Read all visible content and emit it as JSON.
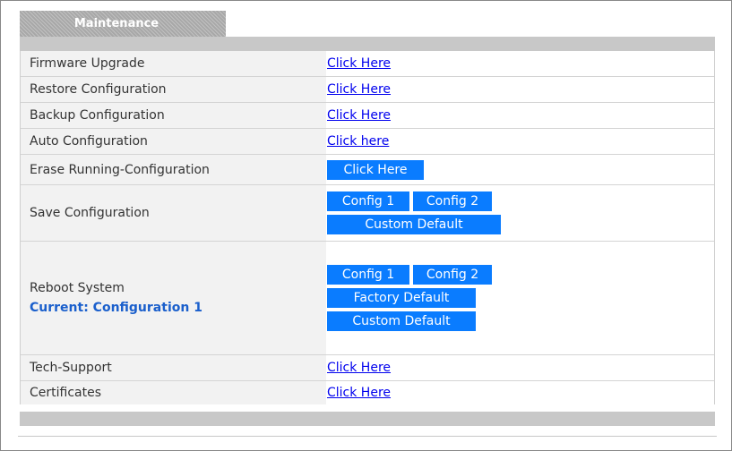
{
  "panel": {
    "title": "Maintenance"
  },
  "rows": {
    "firmware_upgrade": {
      "label": "Firmware Upgrade",
      "action": "Click Here"
    },
    "restore_configuration": {
      "label": "Restore Configuration",
      "action": "Click Here"
    },
    "backup_configuration": {
      "label": "Backup Configuration",
      "action": "Click Here"
    },
    "auto_configuration": {
      "label": "Auto Configuration",
      "action": "Click here"
    },
    "erase_running": {
      "label": "Erase Running-Configuration",
      "action": "Click Here"
    },
    "save_configuration": {
      "label": "Save Configuration",
      "config1": "Config 1",
      "config2": "Config 2",
      "custom_default": "Custom Default"
    },
    "reboot_system": {
      "label": "Reboot System",
      "current": "Current: Configuration 1",
      "config1": "Config 1",
      "config2": "Config 2",
      "factory_default": "Factory Default",
      "custom_default": "Custom Default"
    },
    "tech_support": {
      "label": "Tech-Support",
      "action": "Click Here"
    },
    "certificates": {
      "label": "Certificates",
      "action": "Click Here"
    }
  },
  "colors": {
    "button": "#0a7cff",
    "link": "#0000ee",
    "current_text": "#1a5fcc",
    "header_bar": "#c8c8c8",
    "label_bg": "#f2f2f2"
  }
}
